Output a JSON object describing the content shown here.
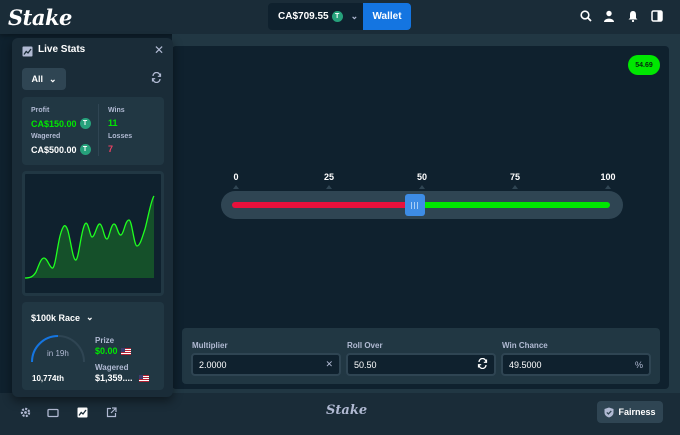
{
  "header": {
    "logo": "Stake",
    "balance": "CA$709.55",
    "coin_symbol": "T",
    "wallet_label": "Wallet",
    "icons": [
      "search-icon",
      "user-icon",
      "bell-icon",
      "sidebar-toggle-icon"
    ]
  },
  "game": {
    "result": "54.69",
    "ticks": [
      "0",
      "25",
      "50",
      "75",
      "100"
    ],
    "slider_value": 50.5,
    "controls": {
      "multiplier_label": "Multiplier",
      "multiplier_value": "2.0000",
      "roll_over_label": "Roll Over",
      "roll_over_value": "50.50",
      "win_chance_label": "Win Chance",
      "win_chance_value": "49.5000",
      "win_chance_suffix": "%"
    }
  },
  "live_stats": {
    "title": "Live Stats",
    "filter": "All",
    "profit_label": "Profit",
    "profit_value": "CA$150.00",
    "wagered_label": "Wagered",
    "wagered_value": "CA$500.00",
    "wins_label": "Wins",
    "wins_value": "11",
    "losses_label": "Losses",
    "losses_value": "7",
    "race": {
      "title": "$100k Race",
      "time": "in 19h",
      "rank": "10,774th",
      "prize_label": "Prize",
      "prize_value": "$0.00",
      "wagered_label": "Wagered",
      "wagered_value": "$1,359...."
    }
  },
  "footer": {
    "logo": "Stake",
    "fairness_label": "Fairness",
    "icons": [
      "settings-icon",
      "theatre-mode-icon",
      "live-stats-icon",
      "popout-icon"
    ]
  },
  "colors": {
    "accent_green": "#00e701",
    "accent_red": "#e9113c",
    "accent_blue": "#1475e1",
    "background": "#0f212e"
  }
}
